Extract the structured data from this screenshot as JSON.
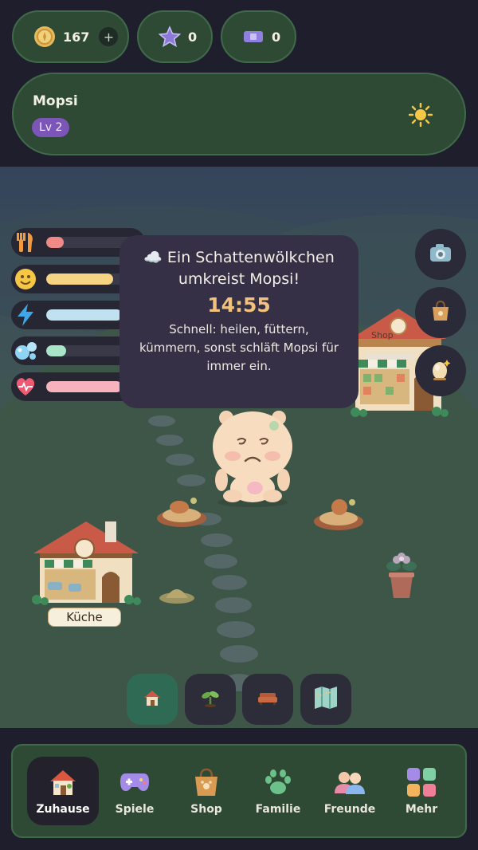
{
  "currency": {
    "coins": "167",
    "coins_plus": "+",
    "stars": "0",
    "tickets": "0"
  },
  "profile": {
    "name": "Mopsi",
    "level": "Lv 2",
    "weather_icon": "sun-icon"
  },
  "stats": [
    {
      "name": "hunger",
      "icon": "fork-knife-icon",
      "level": 0.2,
      "color": "#f08a86"
    },
    {
      "name": "mood",
      "icon": "smiley-icon",
      "level": 0.75,
      "color": "#f6d484"
    },
    {
      "name": "energy",
      "icon": "lightning-icon",
      "level": 0.85,
      "color": "#bfe1f0"
    },
    {
      "name": "hygiene",
      "icon": "bubbles-icon",
      "level": 0.22,
      "color": "#a9e5c9"
    },
    {
      "name": "health",
      "icon": "heart-icon",
      "level": 0.85,
      "color": "#f6b3be"
    }
  ],
  "tooltip": {
    "title": "☁️ Ein Schattenwölkchen umkreist Mopsi!",
    "timer": "14:55",
    "message": "Schnell: heilen, füttern, kümmern, sonst schläft Mopsi für immer ein."
  },
  "scene": {
    "kitchen_label": "Küche",
    "shop_sign": "Shop"
  },
  "side_buttons": [
    "camera-icon",
    "bag-icon",
    "egg-icon"
  ],
  "tools": [
    {
      "name": "home",
      "icon": "house-icon",
      "active": true
    },
    {
      "name": "garden",
      "icon": "sprout-icon",
      "active": false
    },
    {
      "name": "furniture",
      "icon": "sofa-icon",
      "active": false
    },
    {
      "name": "map",
      "icon": "map-icon",
      "active": false
    }
  ],
  "nav": [
    {
      "label": "Zuhause",
      "icon": "house-icon",
      "active": true
    },
    {
      "label": "Spiele",
      "icon": "gamepad-icon",
      "active": false
    },
    {
      "label": "Shop",
      "icon": "shopping-bag-icon",
      "active": false
    },
    {
      "label": "Familie",
      "icon": "paw-icon",
      "active": false
    },
    {
      "label": "Freunde",
      "icon": "friends-icon",
      "active": false
    },
    {
      "label": "Mehr",
      "icon": "grid-icon",
      "active": false
    }
  ]
}
